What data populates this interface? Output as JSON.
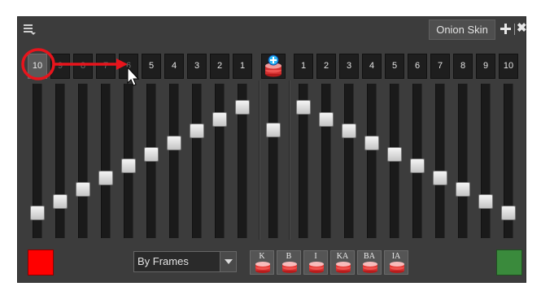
{
  "header": {
    "menu_icon": "hamburger-menu-icon",
    "tab_label": "Onion Skin",
    "add_icon": "plus-icon",
    "close_icon": "close-icon",
    "close_glyph": "✖"
  },
  "previous_frames": {
    "buttons": [
      "10",
      "9",
      "8",
      "7",
      "6",
      "5",
      "4",
      "3",
      "2",
      "1"
    ],
    "active": "10"
  },
  "center_button_icon": "onion-skin-add-icon",
  "next_frames": {
    "buttons": [
      "1",
      "2",
      "3",
      "4",
      "5",
      "6",
      "7",
      "8",
      "9",
      "10"
    ]
  },
  "sliders": {
    "previous_levels": [
      0.1,
      0.19,
      0.28,
      0.37,
      0.46,
      0.55,
      0.64,
      0.73,
      0.82,
      0.91
    ],
    "center_level": 0.74,
    "next_levels": [
      0.91,
      0.82,
      0.73,
      0.64,
      0.55,
      0.46,
      0.37,
      0.28,
      0.19,
      0.1
    ]
  },
  "colors": {
    "previous_swatch": "#ff0000",
    "next_swatch": "#3a8a3c",
    "annotation": "#e8141c"
  },
  "mode_select": {
    "value": "By Frames"
  },
  "filter_buttons": [
    {
      "label": "K",
      "name": "key-drawings-filter-button"
    },
    {
      "label": "B",
      "name": "breakdown-drawings-filter-button"
    },
    {
      "label": "I",
      "name": "inbetween-drawings-filter-button"
    },
    {
      "label": "KA",
      "name": "key-annotation-filter-button"
    },
    {
      "label": "BA",
      "name": "breakdown-annotation-filter-button"
    },
    {
      "label": "IA",
      "name": "inbetween-annotation-filter-button"
    }
  ]
}
